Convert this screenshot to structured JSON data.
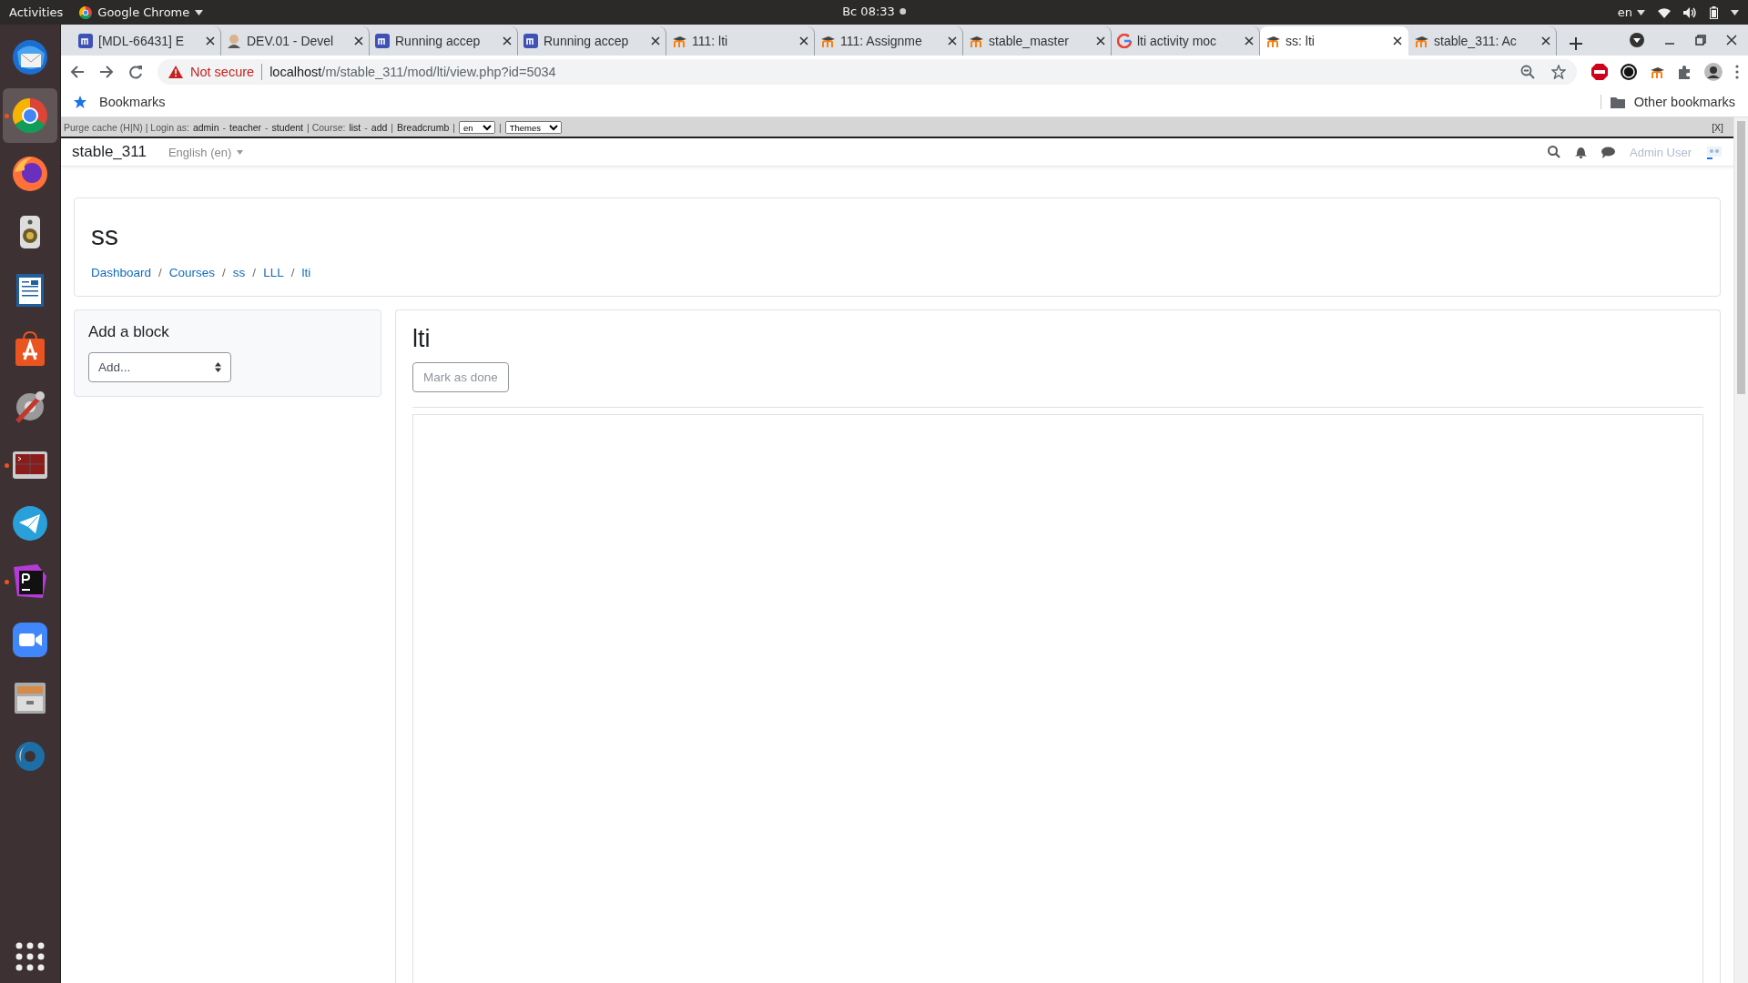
{
  "topbar": {
    "activities": "Activities",
    "app": "Google Chrome",
    "clock": "Вс 08:33",
    "language": "en"
  },
  "dock": [
    {
      "kind": "mail",
      "selected": false,
      "running": false
    },
    {
      "kind": "chrome",
      "selected": true,
      "running": true
    },
    {
      "kind": "firefox",
      "selected": false,
      "running": false
    },
    {
      "kind": "speaker",
      "selected": false,
      "running": false
    },
    {
      "kind": "writer",
      "selected": false,
      "running": false
    },
    {
      "kind": "store",
      "selected": false,
      "running": false
    },
    {
      "kind": "tools",
      "selected": false,
      "running": false
    },
    {
      "kind": "terminal",
      "selected": false,
      "running": true
    },
    {
      "kind": "telegram",
      "selected": false,
      "running": false
    },
    {
      "kind": "ide",
      "selected": false,
      "running": true
    },
    {
      "kind": "video",
      "selected": false,
      "running": false
    },
    {
      "kind": "files",
      "selected": false,
      "running": false
    },
    {
      "kind": "aperture",
      "selected": false,
      "running": false
    }
  ],
  "tabs": [
    {
      "title": "[MDL-66431] E",
      "kind": "tracker",
      "selected": false
    },
    {
      "title": "DEV.01 - Devel",
      "kind": "person",
      "selected": false
    },
    {
      "title": "Running accep",
      "kind": "tracker",
      "selected": false
    },
    {
      "title": "Running accep",
      "kind": "tracker",
      "selected": false
    },
    {
      "title": "111: lti",
      "kind": "moodle",
      "selected": false
    },
    {
      "title": "111: Assignme",
      "kind": "moodle",
      "selected": false
    },
    {
      "title": "stable_master",
      "kind": "moodle",
      "selected": false
    },
    {
      "title": "lti activity moc",
      "kind": "google",
      "selected": false
    },
    {
      "title": "ss: lti",
      "kind": "moodle",
      "selected": true
    },
    {
      "title": "stable_311: Ac",
      "kind": "moodle",
      "selected": false
    }
  ],
  "address": {
    "security": "Not secure",
    "host": "localhost",
    "path": "/m/stable_311/mod/lti/view.php?id=5034"
  },
  "bookmarks": {
    "label": "Bookmarks",
    "other": "Other bookmarks"
  },
  "dev_toolbar": {
    "parts": [
      {
        "kind": "text",
        "text": "Purge cache (H|N) | Login as:"
      },
      {
        "kind": "link",
        "text": "admin"
      },
      {
        "kind": "text",
        "text": "-"
      },
      {
        "kind": "link",
        "text": "teacher"
      },
      {
        "kind": "text",
        "text": "-"
      },
      {
        "kind": "link",
        "text": "student"
      },
      {
        "kind": "text",
        "text": "| Course:"
      },
      {
        "kind": "link",
        "text": "list"
      },
      {
        "kind": "text",
        "text": "-"
      },
      {
        "kind": "link",
        "text": "add"
      },
      {
        "kind": "text",
        "text": "|"
      },
      {
        "kind": "link",
        "text": "Breadcrumb"
      },
      {
        "kind": "text",
        "text": "|"
      },
      {
        "kind": "select",
        "text": "en"
      },
      {
        "kind": "text",
        "text": "|"
      },
      {
        "kind": "select",
        "text": "Themes"
      }
    ],
    "close": "[X]"
  },
  "navbar": {
    "site": "stable_311",
    "language": "English (en)",
    "user": "Admin User"
  },
  "header": {
    "title": "ss",
    "breadcrumb": [
      {
        "kind": "link",
        "text": "Dashboard"
      },
      {
        "kind": "separator",
        "text": "/"
      },
      {
        "kind": "link",
        "text": "Courses"
      },
      {
        "kind": "separator",
        "text": "/"
      },
      {
        "kind": "link",
        "text": "ss"
      },
      {
        "kind": "separator",
        "text": "/"
      },
      {
        "kind": "link",
        "text": "LLL"
      },
      {
        "kind": "separator",
        "text": "/"
      },
      {
        "kind": "link",
        "text": "lti"
      }
    ]
  },
  "block": {
    "title": "Add a block",
    "select": "Add..."
  },
  "activity": {
    "title": "lti",
    "button": "Mark as done"
  }
}
